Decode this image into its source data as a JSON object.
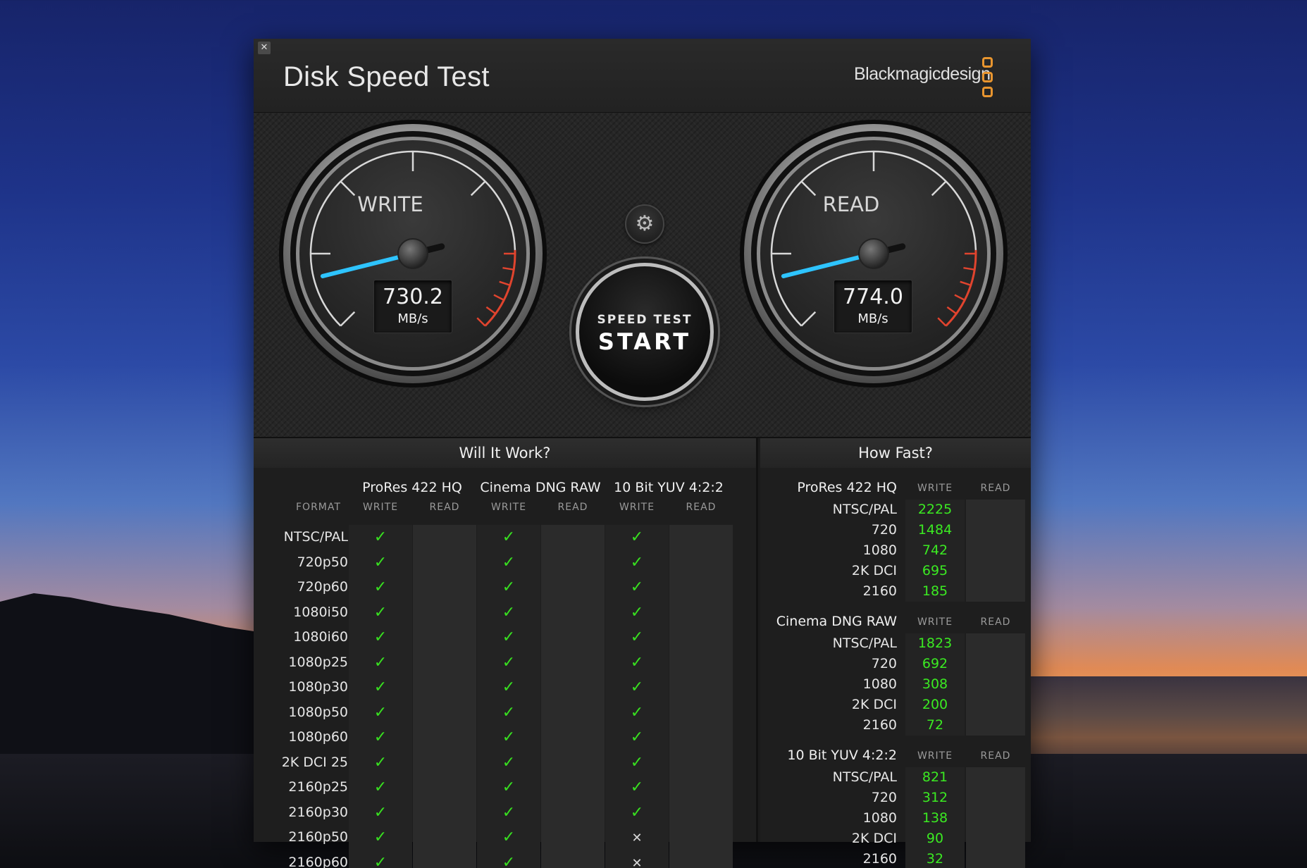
{
  "window": {
    "title": "Disk Speed Test",
    "brand": "Blackmagicdesign",
    "close_label": "✕"
  },
  "gauges": {
    "write": {
      "label": "WRITE",
      "value": "730.2",
      "unit": "MB/s"
    },
    "read": {
      "label": "READ",
      "value": "774.0",
      "unit": "MB/s"
    }
  },
  "controls": {
    "start_small": "SPEED TEST",
    "start_big": "START",
    "settings_icon": "gear-icon"
  },
  "will_it_work": {
    "title": "Will It Work?",
    "format_label": "FORMAT",
    "write_label": "WRITE",
    "read_label": "READ",
    "groups": [
      "ProRes 422 HQ",
      "Cinema DNG RAW",
      "10 Bit YUV 4:2:2"
    ],
    "rows": [
      {
        "format": "NTSC/PAL",
        "cells": [
          "✓",
          "",
          "✓",
          "",
          "✓",
          ""
        ]
      },
      {
        "format": "720p50",
        "cells": [
          "✓",
          "",
          "✓",
          "",
          "✓",
          ""
        ]
      },
      {
        "format": "720p60",
        "cells": [
          "✓",
          "",
          "✓",
          "",
          "✓",
          ""
        ]
      },
      {
        "format": "1080i50",
        "cells": [
          "✓",
          "",
          "✓",
          "",
          "✓",
          ""
        ]
      },
      {
        "format": "1080i60",
        "cells": [
          "✓",
          "",
          "✓",
          "",
          "✓",
          ""
        ]
      },
      {
        "format": "1080p25",
        "cells": [
          "✓",
          "",
          "✓",
          "",
          "✓",
          ""
        ]
      },
      {
        "format": "1080p30",
        "cells": [
          "✓",
          "",
          "✓",
          "",
          "✓",
          ""
        ]
      },
      {
        "format": "1080p50",
        "cells": [
          "✓",
          "",
          "✓",
          "",
          "✓",
          ""
        ]
      },
      {
        "format": "1080p60",
        "cells": [
          "✓",
          "",
          "✓",
          "",
          "✓",
          ""
        ]
      },
      {
        "format": "2K DCI 25",
        "cells": [
          "✓",
          "",
          "✓",
          "",
          "✓",
          ""
        ]
      },
      {
        "format": "2160p25",
        "cells": [
          "✓",
          "",
          "✓",
          "",
          "✓",
          ""
        ]
      },
      {
        "format": "2160p30",
        "cells": [
          "✓",
          "",
          "✓",
          "",
          "✓",
          ""
        ]
      },
      {
        "format": "2160p50",
        "cells": [
          "✓",
          "",
          "✓",
          "",
          "✕",
          ""
        ]
      },
      {
        "format": "2160p60",
        "cells": [
          "✓",
          "",
          "✓",
          "",
          "✕",
          ""
        ]
      }
    ]
  },
  "how_fast": {
    "title": "How Fast?",
    "write_label": "WRITE",
    "read_label": "READ",
    "groups": [
      {
        "name": "ProRes 422 HQ",
        "rows": [
          {
            "format": "NTSC/PAL",
            "write": "2225",
            "read": ""
          },
          {
            "format": "720",
            "write": "1484",
            "read": ""
          },
          {
            "format": "1080",
            "write": "742",
            "read": ""
          },
          {
            "format": "2K DCI",
            "write": "695",
            "read": ""
          },
          {
            "format": "2160",
            "write": "185",
            "read": ""
          }
        ]
      },
      {
        "name": "Cinema DNG RAW",
        "rows": [
          {
            "format": "NTSC/PAL",
            "write": "1823",
            "read": ""
          },
          {
            "format": "720",
            "write": "692",
            "read": ""
          },
          {
            "format": "1080",
            "write": "308",
            "read": ""
          },
          {
            "format": "2K DCI",
            "write": "200",
            "read": ""
          },
          {
            "format": "2160",
            "write": "72",
            "read": ""
          }
        ]
      },
      {
        "name": "10 Bit YUV 4:2:2",
        "rows": [
          {
            "format": "NTSC/PAL",
            "write": "821",
            "read": ""
          },
          {
            "format": "720",
            "write": "312",
            "read": ""
          },
          {
            "format": "1080",
            "write": "138",
            "read": ""
          },
          {
            "format": "2K DCI",
            "write": "90",
            "read": ""
          },
          {
            "format": "2160",
            "write": "32",
            "read": ""
          }
        ]
      }
    ]
  },
  "colors": {
    "needle": "#2ec4ff",
    "redline": "#e0442e",
    "check": "#38e020",
    "fast_value": "#3bea22",
    "brand_orange": "#e8952f"
  }
}
